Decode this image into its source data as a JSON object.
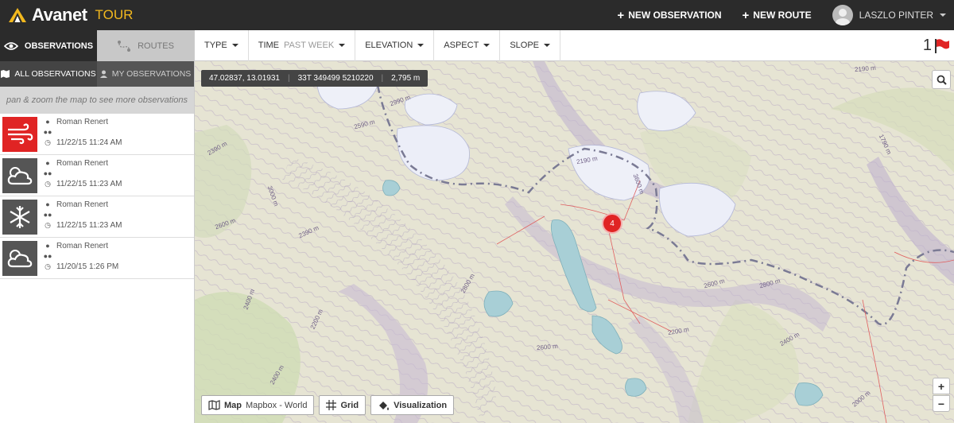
{
  "header": {
    "brand": "Avanet",
    "brand_suffix": "TOUR",
    "new_observation": "NEW OBSERVATION",
    "new_route": "NEW ROUTE",
    "user_name": "LASZLO PINTER"
  },
  "sidebar": {
    "tabs": [
      {
        "label": "OBSERVATIONS",
        "icon": "eye-icon"
      },
      {
        "label": "ROUTES",
        "icon": "route-icon"
      }
    ],
    "subtabs": [
      {
        "label": "ALL OBSERVATIONS",
        "icon": "map-icon"
      },
      {
        "label": "MY OBSERVATIONS",
        "icon": "user-icon"
      }
    ],
    "hint": "pan & zoom the map to see more observations",
    "observations": [
      {
        "icon": "wind-icon",
        "author": "Roman Renert",
        "datetime": "11/22/15 11:24 AM",
        "color": "#e02424"
      },
      {
        "icon": "cloud-icon",
        "author": "Roman Renert",
        "datetime": "11/22/15 11:23 AM",
        "color": "#555555"
      },
      {
        "icon": "snowflake-icon",
        "author": "Roman Renert",
        "datetime": "11/22/15 11:23 AM",
        "color": "#555555"
      },
      {
        "icon": "cloud-icon",
        "author": "Roman Renert",
        "datetime": "11/20/15 1:26 PM",
        "color": "#555555"
      }
    ]
  },
  "filters": [
    {
      "label": "TYPE",
      "value": ""
    },
    {
      "label": "TIME",
      "value": "PAST WEEK"
    },
    {
      "label": "ELEVATION",
      "value": ""
    },
    {
      "label": "ASPECT",
      "value": ""
    },
    {
      "label": "SLOPE",
      "value": ""
    }
  ],
  "flag_count": "1",
  "map": {
    "coords": "47.02837, 13.01931",
    "utm": "33T 349499 5210220",
    "altitude": "2,795 m",
    "cluster_count": "4",
    "layer_label": "Map",
    "layer_value": "Mapbox - World",
    "grid_label": "Grid",
    "visualization_label": "Visualization",
    "zoom_in": "+",
    "zoom_out": "−",
    "contour_labels": [
      "2390 m",
      "2990 m",
      "2590 m",
      "3000 m",
      "2190 m",
      "3600 m",
      "2390 m",
      "2600 m",
      "2800 m",
      "2200 m",
      "2400 m",
      "2600 m",
      "1790 m",
      "2190 m",
      "2800 m",
      "2600 m",
      "2400 m",
      "2000 m",
      "2200 m",
      "2400 m"
    ]
  }
}
